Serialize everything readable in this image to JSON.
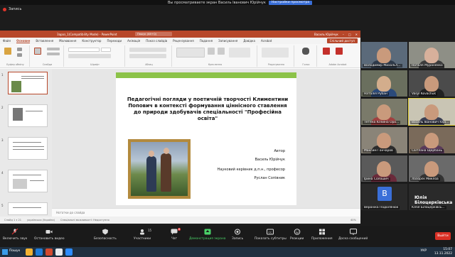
{
  "zoom": {
    "recording_label": "Запись",
    "share_banner_text": "Вы просматриваете экран Василь Іванович Юрійчук",
    "share_banner_button": "Настройки просмотра",
    "toolbar": [
      {
        "label": "Включить звук"
      },
      {
        "label": "Остановить видео"
      },
      {
        "label": "Безопасность"
      },
      {
        "label": "Участники",
        "count": "15"
      },
      {
        "label": "Чат",
        "count": "6"
      },
      {
        "label": "Демонстрация экрана"
      },
      {
        "label": "Запись"
      },
      {
        "label": "Показать субтитры"
      },
      {
        "label": "Реакции"
      },
      {
        "label": "Приложения"
      },
      {
        "label": "Доска сообщений"
      }
    ],
    "end_label": "Выйти"
  },
  "powerpoint": {
    "title": "Зараз_1(Compatibility Mode) - PowerPoint",
    "search_placeholder": "Пошук (Alt+Q)",
    "user": "Василь Юрійчук",
    "tabs": [
      "Файл",
      "Основне",
      "Вставлення",
      "Малювання",
      "Конструктор",
      "Переходи",
      "Анімація",
      "Показ слайдів",
      "Рецензування",
      "Подання",
      "Записування",
      "Довідка",
      "Acrobat"
    ],
    "active_tab": "Основне",
    "share_button": "Спільний доступ",
    "ribbon_groups": [
      "Буфер обміну",
      "Слайди",
      "Шрифт",
      "Абзац",
      "Креслення",
      "Редагування",
      "Голос",
      "Adobe Acrobat"
    ],
    "notes_placeholder": "Нотатки до слайда",
    "status_left": "Слайд 1 з 21",
    "status_lang": "українська (Україна)",
    "status_access": "Спеціальні можливості: Недоступно",
    "status_zoom": "40%",
    "thumb_numbers": [
      "1",
      "2",
      "3",
      "4",
      "5"
    ]
  },
  "slide": {
    "title": "Педагогічні погляди у поетичній творчості Климентини Попович в контексті формування ціннісного ставлення до природи здобувачів спеціальності \"Професійна освіта\"",
    "author_label": "Автор",
    "author": "Василь Юрійчук",
    "supervisor_label": "Науковий керівник д.п.н., професор",
    "supervisor": "Руслан Сопівник"
  },
  "participants": [
    {
      "name": "Володимир Михальч..."
    },
    {
      "name": "Наталя Мураненко"
    },
    {
      "name": "Наталія Рубан"
    },
    {
      "name": "Vasyl Kovachuk"
    },
    {
      "name": "Тетяна Юлійна Оро..."
    },
    {
      "name": "Василь Іванович Юрі..."
    },
    {
      "name": "Максим Гончаров"
    },
    {
      "name": "Світлана Щербань"
    },
    {
      "name": "Ірина Солошич"
    },
    {
      "name": "Лазорєк Миклоа"
    },
    {
      "name": "Вероніка Подолянюк"
    },
    {
      "name": "Юлія Білоцерківська",
      "avatar_letter": "В"
    },
    {
      "name": "Юлія Білоцерківсь..."
    }
  ],
  "taskbar": {
    "search_label": "Пошук",
    "lang": "УКР",
    "time": "15:07",
    "date": "13.11.2022"
  }
}
